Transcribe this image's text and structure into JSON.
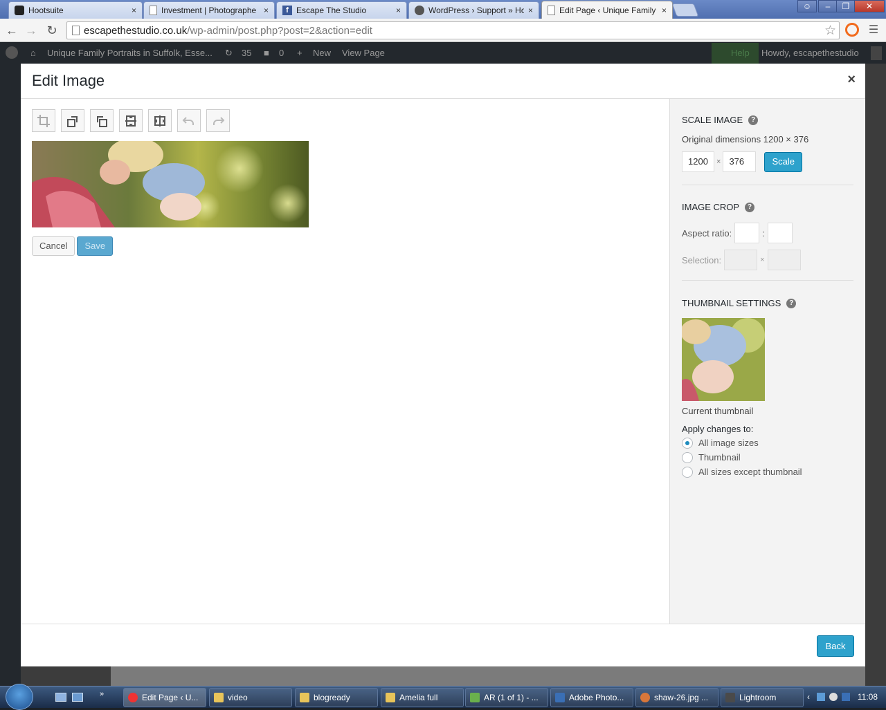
{
  "browser": {
    "tabs": [
      {
        "title": "Hootsuite",
        "icon": "hootsuite-icon"
      },
      {
        "title": "Investment | Photographe",
        "icon": "page-icon"
      },
      {
        "title": "Escape The Studio",
        "icon": "facebook-icon"
      },
      {
        "title": "WordPress › Support » Ho",
        "icon": "wordpress-icon"
      },
      {
        "title": "Edit Page ‹ Unique Family",
        "icon": "page-icon"
      }
    ],
    "url_host": "escapethestudio.co.uk",
    "url_path": "/wp-admin/post.php?post=2&action=edit"
  },
  "adminbar": {
    "site_title": "Unique Family Portraits in Suffolk, Esse...",
    "updates_count": "35",
    "comments_count": "0",
    "new_label": "New",
    "view_label": "View Page",
    "help_label": "Help",
    "howdy": "Howdy, escapethestudio"
  },
  "modal": {
    "title": "Edit Image",
    "close_glyph": "×",
    "toolbar": {
      "buttons": [
        "crop-icon",
        "rotate-left-icon",
        "rotate-right-icon",
        "flip-vertical-icon",
        "flip-horizontal-icon",
        "undo-icon",
        "redo-icon"
      ]
    },
    "cancel_label": "Cancel",
    "save_label": "Save",
    "back_label": "Back"
  },
  "sidebar": {
    "scale": {
      "heading": "Scale Image",
      "original_dims": "Original dimensions 1200 × 376",
      "width": "1200",
      "times": "×",
      "height": "376",
      "button": "Scale"
    },
    "crop": {
      "heading": "Image Crop",
      "aspect_label": "Aspect ratio:",
      "aspect_sep": ":",
      "selection_label": "Selection:",
      "selection_sep": "×"
    },
    "thumb": {
      "heading": "Thumbnail Settings",
      "caption": "Current thumbnail",
      "apply_label": "Apply changes to:",
      "options": [
        "All image sizes",
        "Thumbnail",
        "All sizes except thumbnail"
      ],
      "selected_index": 0
    }
  },
  "taskbar": {
    "items": [
      "Edit Page ‹ U...",
      "video",
      "blogready",
      "Amelia full",
      "AR (1 of 1) - ...",
      "Adobe Photo...",
      "shaw-26.jpg ...",
      "Lightroom"
    ],
    "clock": "11:08"
  },
  "colors": {
    "primary": "#2ea2cc",
    "adminbar": "#23282d"
  }
}
